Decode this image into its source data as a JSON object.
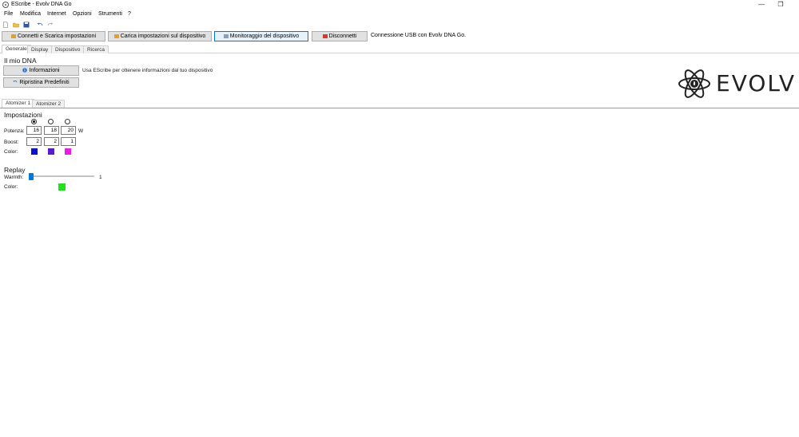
{
  "window": {
    "title": "EScribe - Evolv DNA Go",
    "minimize_glyph": "—",
    "restore_glyph": "❐"
  },
  "menu": [
    "File",
    "Modifica",
    "Internet",
    "Opzioni",
    "Strumenti",
    "?"
  ],
  "toolbar_icons": [
    "new-file-icon",
    "open-folder-icon",
    "save-icon",
    "undo-icon",
    "redo-icon"
  ],
  "actions": {
    "connect_download": "Connetti e Scarica impostazioni",
    "upload_settings": "Carica impostazioni sul dispositivo",
    "device_monitor": "Monitoraggio del dispositivo",
    "disconnect": "Disconnetti",
    "connection_status": "Connessione USB con Evolv DNA Go."
  },
  "main_tabs": [
    "Generale",
    "Display",
    "Dispositivo",
    "Ricerca"
  ],
  "my_dna": {
    "title": "Il mio DNA",
    "info_button": "Informazioni",
    "info_description": "Usa EScribe per ottenere informazioni dal tuo dispositivo",
    "reset_button": "Ripristina Predefiniti"
  },
  "logo": {
    "text": "EVOLV"
  },
  "atomizer_tabs": [
    "Atomizer 1",
    "Atomizer 2"
  ],
  "impostazioni": {
    "title": "Impostazioni",
    "selected_preset": 0,
    "power_label": "Potenza:",
    "power_values": [
      "16",
      "18",
      "20"
    ],
    "power_unit": "W",
    "boost_label": "Boost:",
    "boost_values": [
      "2",
      "2",
      "1"
    ],
    "color_label": "Color:",
    "colors": [
      "#0a14c8",
      "#5a1ac8",
      "#e61ee6"
    ]
  },
  "replay": {
    "title": "Replay",
    "warmth_label": "Warmth:",
    "warmth_value": "1",
    "warmth_fraction": 0.0,
    "color_label": "Color:",
    "color": "#22e01e"
  },
  "accent": "#0078d7"
}
